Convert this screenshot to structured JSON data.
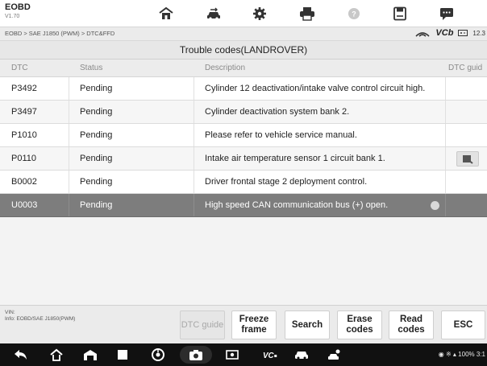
{
  "app": {
    "name": "EOBD",
    "version": "V1.70"
  },
  "toolbar": {
    "icons": [
      "home-icon",
      "vehicle-swap-icon",
      "settings-gear-icon",
      "print-icon",
      "help-icon",
      "save-icon",
      "message-icon"
    ]
  },
  "breadcrumb": {
    "path": "EOBD > SAE J1850 (PWM) > DTC&FFD",
    "vci": "VCb",
    "battery": "12.3"
  },
  "table": {
    "title": "Trouble codes(LANDROVER)",
    "headers": {
      "dtc": "DTC",
      "status": "Status",
      "description": "Description",
      "guide": "DTC guid"
    },
    "rows": [
      {
        "dtc": "P3492",
        "status": "Pending",
        "description": "Cylinder 12 deactivation/intake valve control circuit high.",
        "guide": false,
        "selected": false
      },
      {
        "dtc": "P3497",
        "status": "Pending",
        "description": "Cylinder deactivation system bank 2.",
        "guide": false,
        "selected": false
      },
      {
        "dtc": "P1010",
        "status": "Pending",
        "description": "Please refer to vehicle service manual.",
        "guide": false,
        "selected": false
      },
      {
        "dtc": "P0110",
        "status": "Pending",
        "description": "Intake air temperature sensor 1 circuit bank 1.",
        "guide": true,
        "selected": false
      },
      {
        "dtc": "B0002",
        "status": "Pending",
        "description": "Driver frontal stage 2 deployment control.",
        "guide": false,
        "selected": false
      },
      {
        "dtc": "U0003",
        "status": "Pending",
        "description": "High speed CAN communication bus (+) open.",
        "guide": false,
        "selected": true
      }
    ]
  },
  "footer": {
    "vin_label": "VIN:",
    "info": "Info: EOBD/SAE J1850(PWM)",
    "buttons": {
      "dtc_guide": "DTC guide",
      "freeze_frame": "Freeze frame",
      "search": "Search",
      "erase_codes": "Erase codes",
      "read_codes": "Read codes",
      "esc": "ESC"
    }
  },
  "navbar": {
    "status": "100%",
    "time": "3:1"
  },
  "colors": {
    "selected_row": "#7d7d7d",
    "navbar": "#111111",
    "toolbar": "#ffffff"
  }
}
